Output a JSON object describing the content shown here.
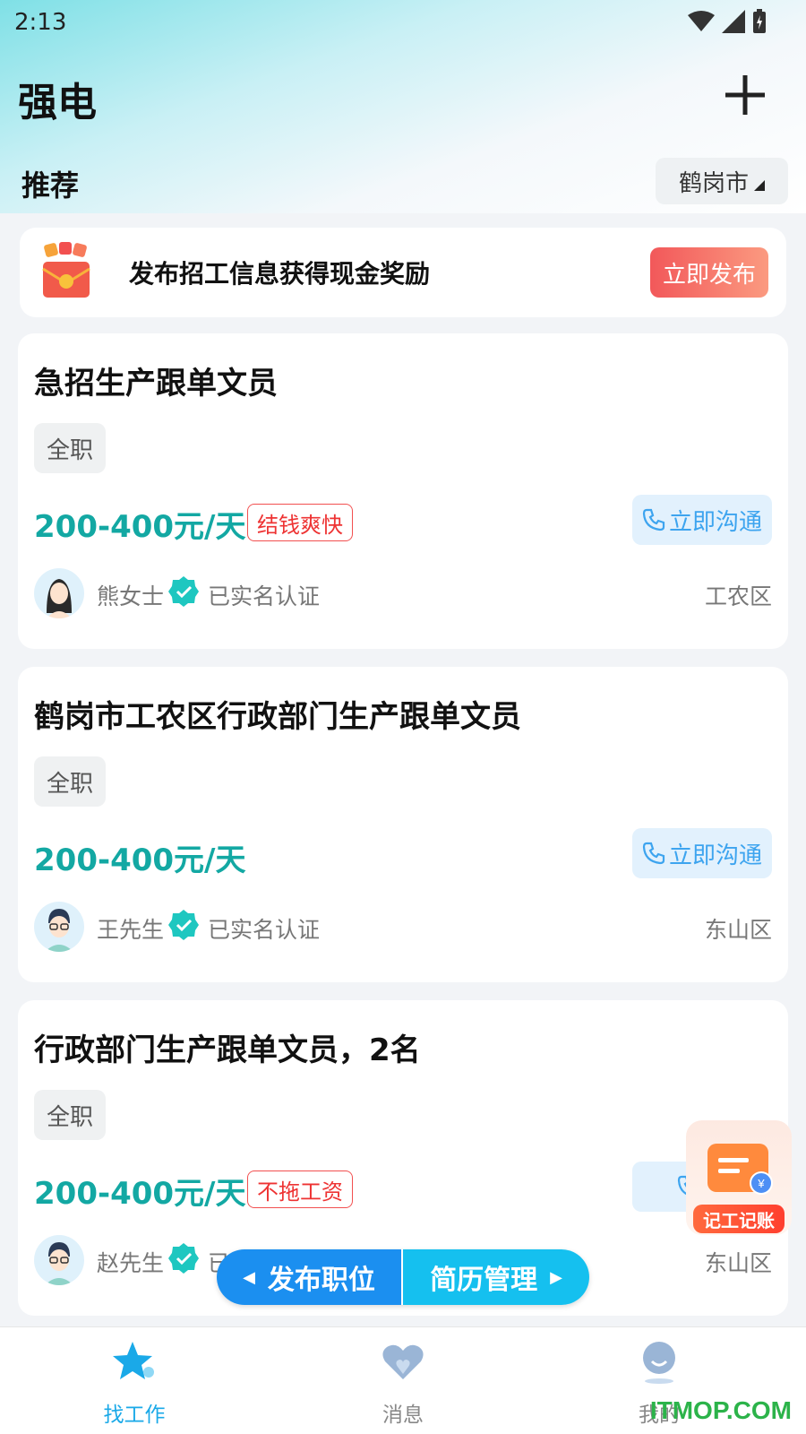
{
  "status_bar": {
    "time": "2:13"
  },
  "header": {
    "title": "强电",
    "section": "推荐",
    "city": "鹤岗市"
  },
  "banner": {
    "text": "发布招工信息获得现金奖励",
    "button": "立即发布"
  },
  "jobs": [
    {
      "title": "急招生产跟单文员",
      "type": "全职",
      "salary": "200-400元/天",
      "pay_tag": "结钱爽快",
      "contact": "立即沟通",
      "person": "熊女士",
      "verified": "已实名认证",
      "district": "工农区"
    },
    {
      "title": "鹤岗市工农区行政部门生产跟单文员",
      "type": "全职",
      "salary": "200-400元/天",
      "pay_tag": "",
      "contact": "立即沟通",
      "person": "王先生",
      "verified": "已实名认证",
      "district": "东山区"
    },
    {
      "title": "行政部门生产跟单文员，2名",
      "type": "全职",
      "salary": "200-400元/天",
      "pay_tag": "不拖工资",
      "contact": "立",
      "person": "赵先生",
      "verified": "已",
      "district": "东山区"
    }
  ],
  "float_widget": {
    "label": "记工记账"
  },
  "action_pill": {
    "left": "发布职位",
    "right": "简历管理"
  },
  "tabbar": [
    {
      "label": "找工作",
      "icon": "star-icon",
      "color": "#1aa9e8"
    },
    {
      "label": "消息",
      "icon": "heart-chat-icon",
      "color": "#888888"
    },
    {
      "label": "我的",
      "icon": "profile-icon",
      "color": "#888888"
    }
  ],
  "watermark": "ITMOP.COM",
  "colors": {
    "accent": "#13a8a3",
    "blue": "#1b8ff0",
    "red": "#f25050"
  }
}
